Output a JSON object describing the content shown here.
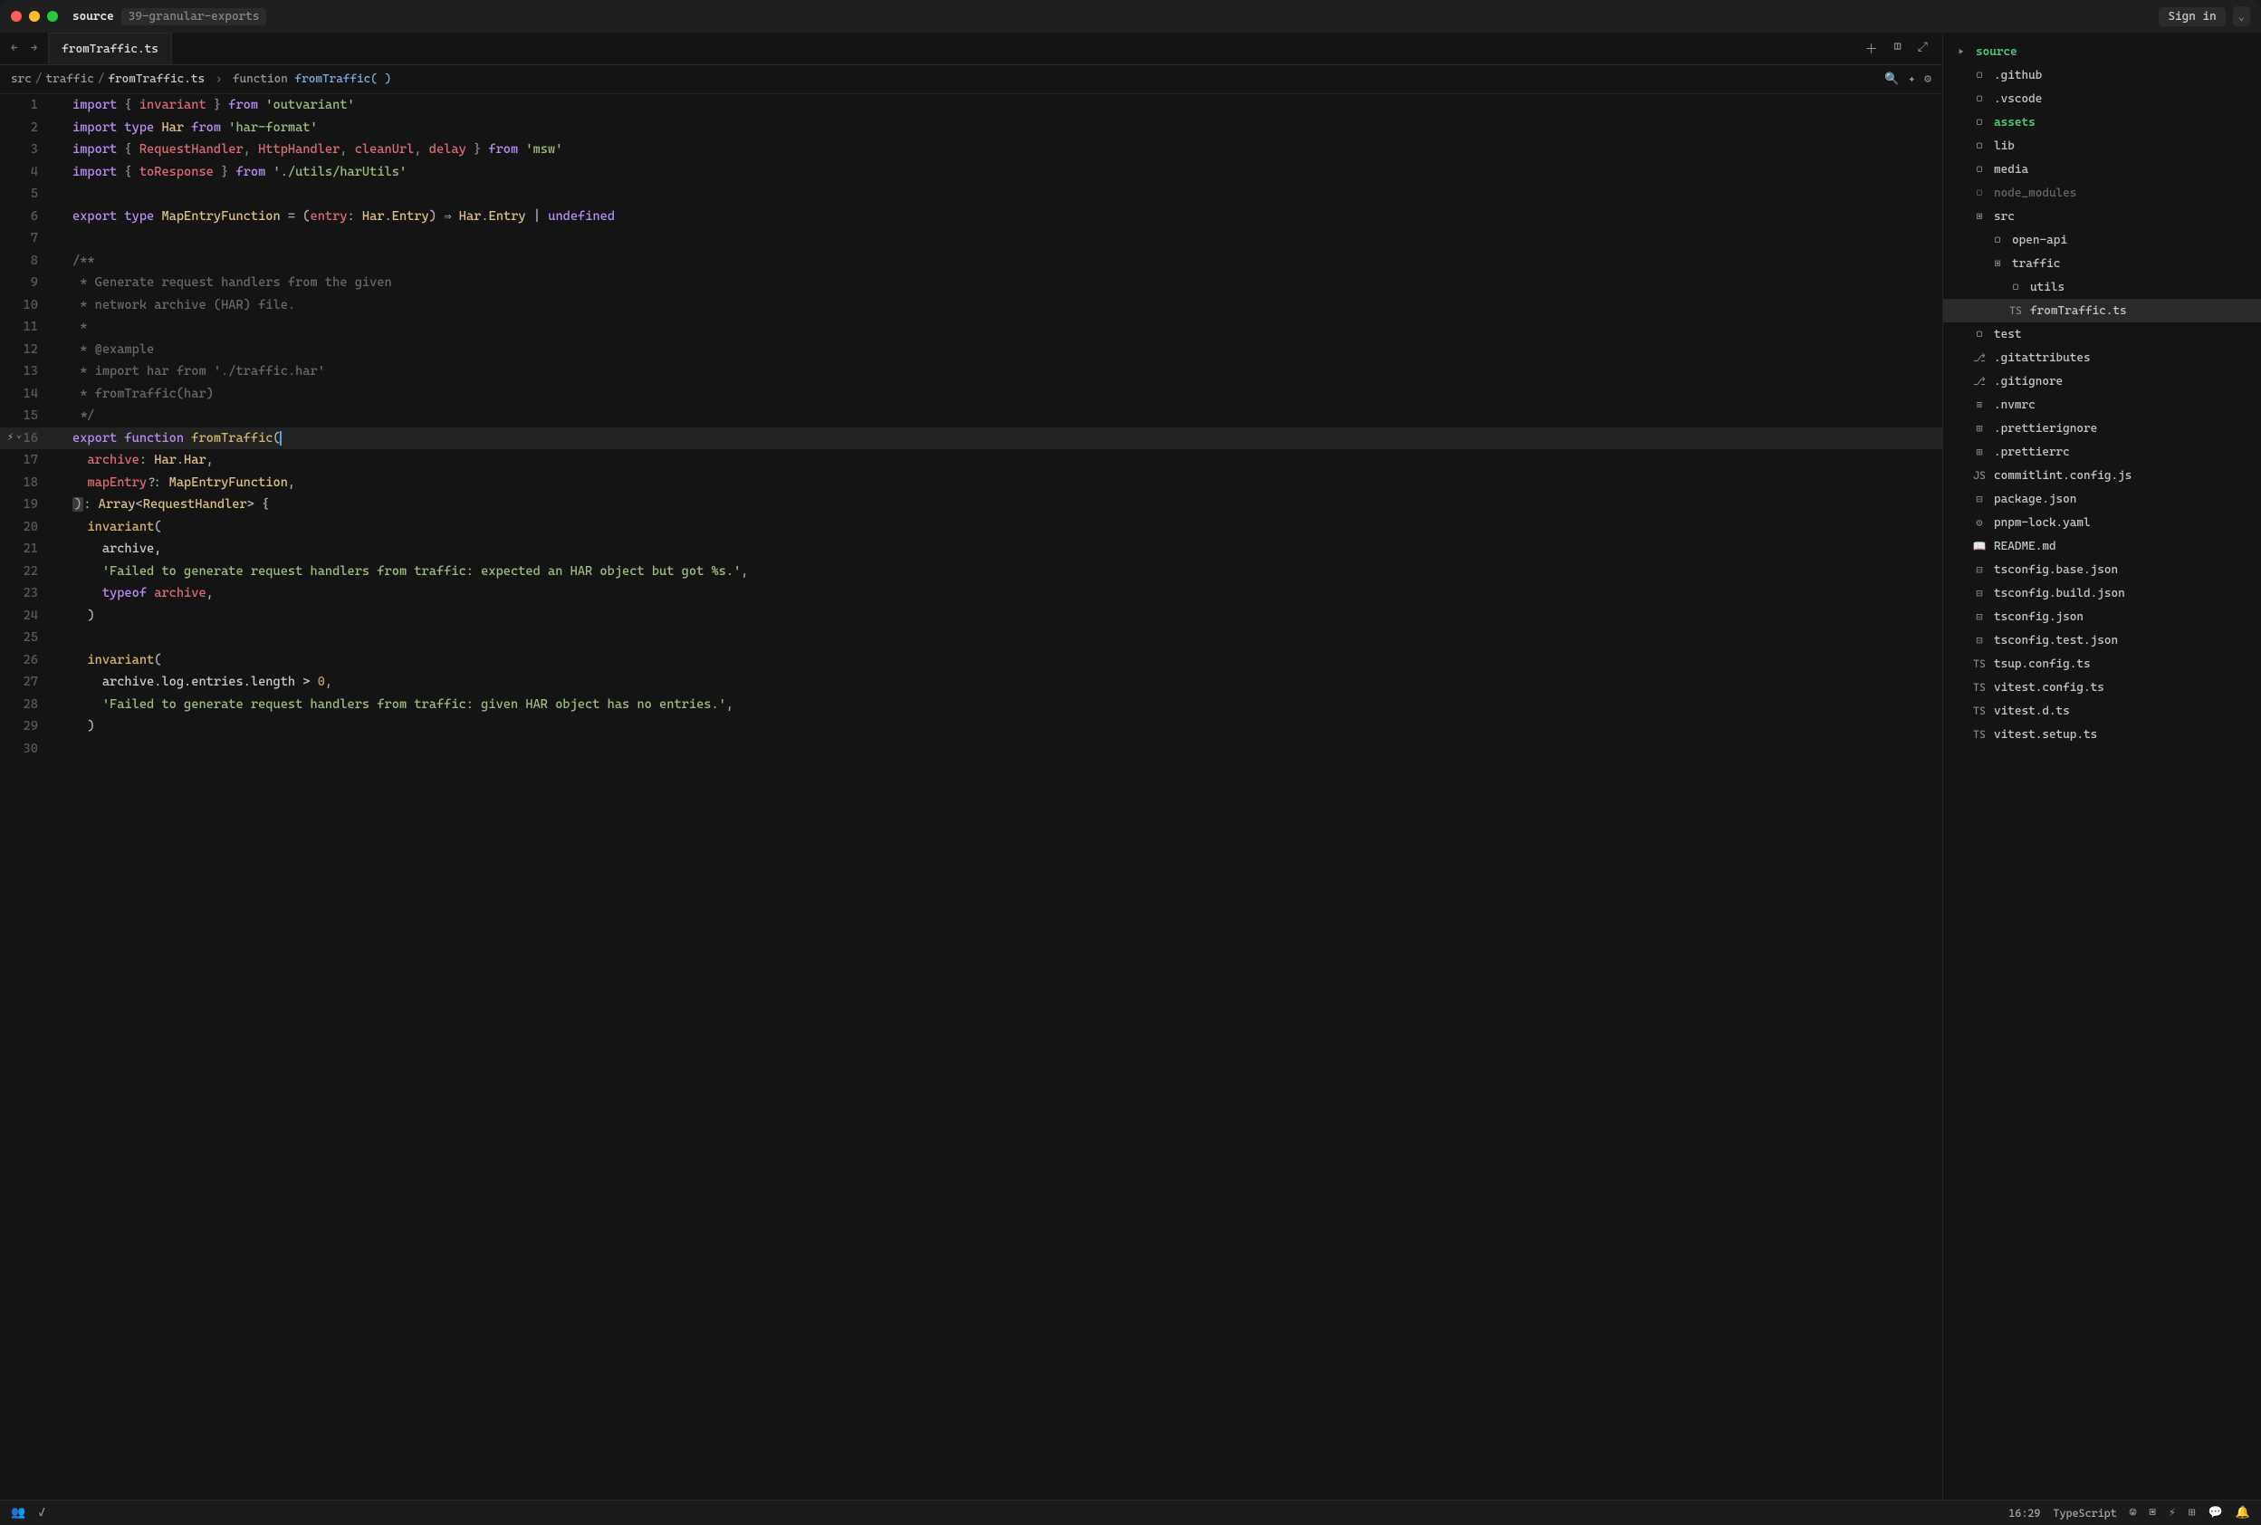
{
  "titlebar": {
    "app": "source",
    "branch": "39-granular-exports",
    "signin": "Sign in"
  },
  "tab": {
    "filename": "fromTraffic.ts"
  },
  "breadcrumb": {
    "p1": "src",
    "p2": "traffic",
    "p3": "fromTraffic.ts",
    "p4": "function",
    "p5": "fromTraffic( )"
  },
  "code": {
    "l1": {
      "a": "import",
      "b": "{ ",
      "c": "invariant",
      "d": " }",
      "e": " from ",
      "f": "'outvariant'"
    },
    "l2": {
      "a": "import",
      "b": " type ",
      "c": "Har",
      "d": " from ",
      "e": "'har-format'"
    },
    "l3": {
      "a": "import",
      "b": "{ ",
      "c": "RequestHandler",
      "d": ", ",
      "e": "HttpHandler",
      "f": ", ",
      "g": "cleanUrl",
      "h": ", ",
      "i": "delay",
      "j": " }",
      "k": " from ",
      "l": "'msw'"
    },
    "l4": {
      "a": "import",
      "b": "{ ",
      "c": "toResponse",
      "d": " }",
      "e": " from ",
      "f": "'./utils/harUtils'"
    },
    "l6": {
      "a": "export",
      "b": " type ",
      "c": "MapEntryFunction",
      "d": " = (",
      "e": "entry",
      "f": ": ",
      "g": "Har",
      "h": ".",
      "i": "Entry",
      "j": ") ⇒ ",
      "k": "Har",
      "l": ".",
      "m": "Entry",
      "n": " | ",
      "o": "undefined"
    },
    "l8": "/**",
    "l9": " * Generate request handlers from the given",
    "l10": " * network archive (HAR) file.",
    "l11": " *",
    "l12": " * @example",
    "l13": " * import har from './traffic.har'",
    "l14": " * fromTraffic(har)",
    "l15": " */",
    "l16": {
      "a": "export",
      "b": " function ",
      "c": "fromTraffic",
      "d": "("
    },
    "l17": {
      "a": "  archive",
      "b": ": ",
      "c": "Har",
      "d": ".",
      "e": "Har",
      "f": ","
    },
    "l18": {
      "a": "  mapEntry",
      "b": "?: ",
      "c": "MapEntryFunction",
      "d": ","
    },
    "l19": {
      "a": ")",
      "b": ": ",
      "c": "Array",
      "d": "<",
      "e": "RequestHandler",
      "f": "> {"
    },
    "l20": {
      "a": "  ",
      "b": "invariant",
      "c": "("
    },
    "l21": {
      "a": "    archive,"
    },
    "l22": {
      "a": "    ",
      "b": "'Failed to generate request handlers from traffic: expected an HAR object but got %s.'",
      "c": ","
    },
    "l23": {
      "a": "    ",
      "b": "typeof",
      "c": " archive",
      "d": ","
    },
    "l24": {
      "a": "  )"
    },
    "l26": {
      "a": "  ",
      "b": "invariant",
      "c": "("
    },
    "l27": {
      "a": "    archive.log.entries.length > ",
      "b": "0",
      "c": ","
    },
    "l28": {
      "a": "    ",
      "b": "'Failed to generate request handlers from traffic: given HAR object has no entries.'",
      "c": ","
    },
    "l29": {
      "a": "  )"
    }
  },
  "lines": [
    "1",
    "2",
    "3",
    "4",
    "5",
    "6",
    "7",
    "8",
    "9",
    "10",
    "11",
    "12",
    "13",
    "14",
    "15",
    "16",
    "17",
    "18",
    "19",
    "20",
    "21",
    "22",
    "23",
    "24",
    "25",
    "26",
    "27",
    "28",
    "29",
    "30"
  ],
  "files": {
    "root": "source",
    "github": ".github",
    "vscode": ".vscode",
    "assets": "assets",
    "lib": "lib",
    "media": "media",
    "node_modules": "node_modules",
    "src": "src",
    "openapi": "open-api",
    "traffic": "traffic",
    "utils": "utils",
    "fromTraffic": "fromTraffic.ts",
    "test": "test",
    "gitattributes": ".gitattributes",
    "gitignore": ".gitignore",
    "nvmrc": ".nvmrc",
    "prettierignore": ".prettierignore",
    "prettierrc": ".prettierrc",
    "commitlint": "commitlint.config.js",
    "package": "package.json",
    "pnpmlock": "pnpm-lock.yaml",
    "readme": "README.md",
    "tsbase": "tsconfig.base.json",
    "tsbuild": "tsconfig.build.json",
    "tsconfig": "tsconfig.json",
    "tstest": "tsconfig.test.json",
    "tsup": "tsup.config.ts",
    "vitestconfig": "vitest.config.ts",
    "vitestd": "vitest.d.ts",
    "vitestsetup": "vitest.setup.ts"
  },
  "status": {
    "pos": "16:29",
    "lang": "TypeScript"
  }
}
